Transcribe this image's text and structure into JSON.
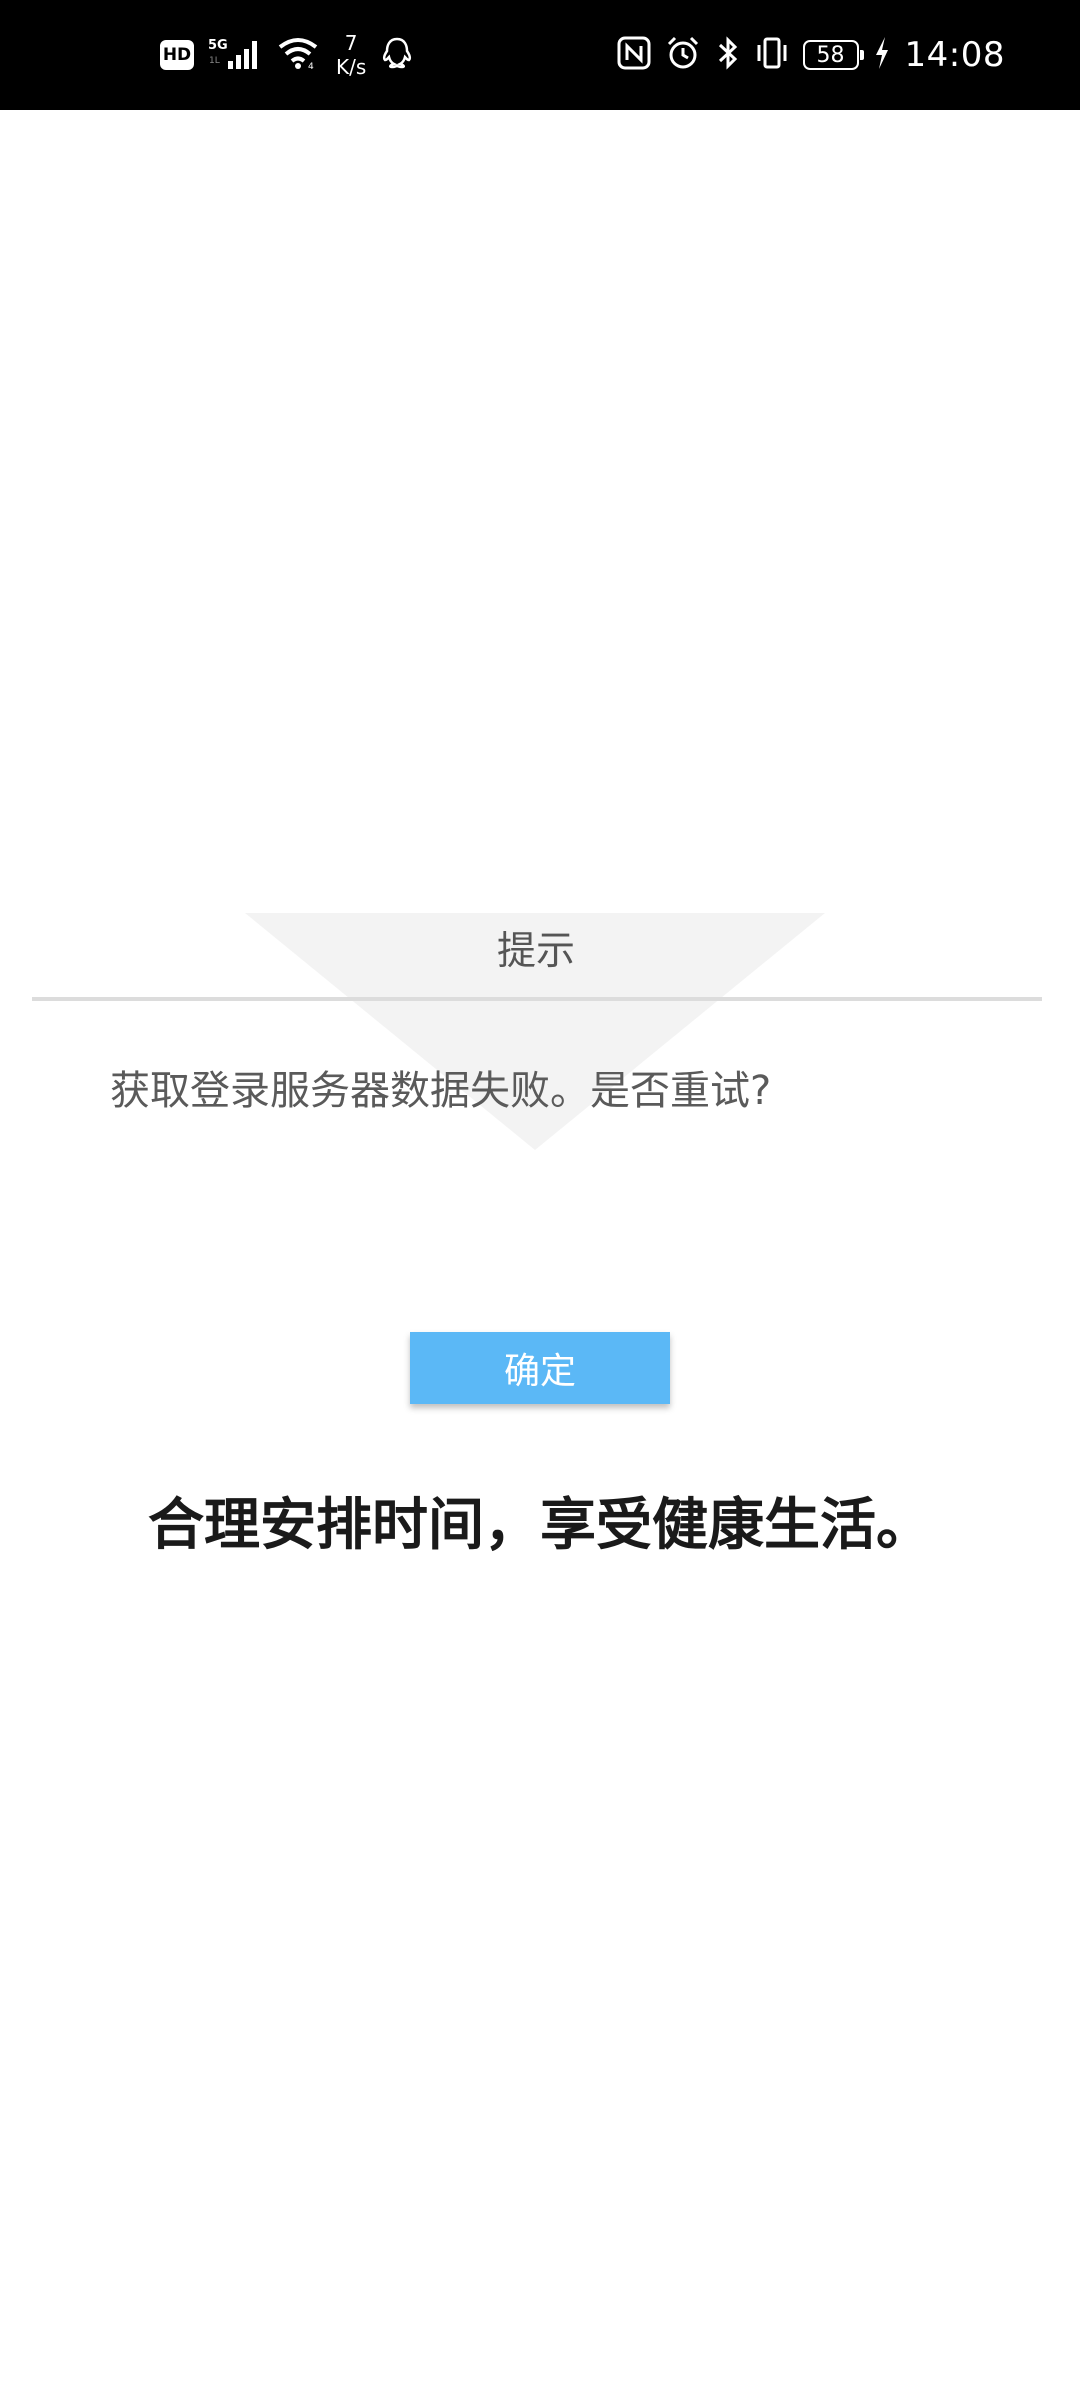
{
  "status_bar": {
    "hd_label": "HD",
    "network_type": "5G",
    "net_speed_value": "7",
    "net_speed_unit": "K/s",
    "battery_level": "58",
    "time": "14:08",
    "icons": [
      "hd-icon",
      "5g-signal-icon",
      "wifi-icon",
      "qq-icon",
      "nfc-icon",
      "alarm-icon",
      "bluetooth-icon",
      "vibrate-icon",
      "battery-icon",
      "charging-icon"
    ]
  },
  "dialog": {
    "title": "提示",
    "message": "获取登录服务器数据失败。是否重试?",
    "confirm_label": "确定"
  },
  "footer": {
    "slogan": "合理安排时间，享受健康生活。"
  },
  "colors": {
    "status_bar_bg": "#000000",
    "button_bg": "#5bb8f6",
    "divider": "#dcdcdc",
    "title_text": "#555555",
    "slogan_text": "#1a1a1a"
  }
}
